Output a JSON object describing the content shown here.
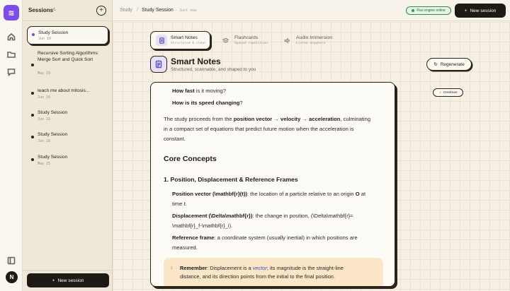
{
  "rail": {
    "logo_glyph": "≋",
    "avatar_initial": "N",
    "icons": [
      "home-icon",
      "folder-icon",
      "chat-icon",
      "panel-icon"
    ]
  },
  "sidebar": {
    "title": "Sessions",
    "count": "6",
    "add_glyph": "+",
    "sessions": [
      {
        "name": "Study Session",
        "date": "Jun 19",
        "active": true
      },
      {
        "name": "Recursive Sorting Algorithms: Merge Sort and Quick Sort",
        "date": "May 29",
        "active": false
      },
      {
        "name": "teach me about mitosis...",
        "date": "Jun 18",
        "active": false
      },
      {
        "name": "Study Session",
        "date": "Jun 18",
        "active": false
      },
      {
        "name": "Study Session",
        "date": "Jun 18",
        "active": false
      },
      {
        "name": "Study Session",
        "date": "May 25",
        "active": false
      }
    ],
    "new_session_label": "New session"
  },
  "topbar": {
    "crumb_root": "Study",
    "crumb_sep": "/",
    "crumb_current": "Study Session",
    "time": "· Just now",
    "engine_label": "Flux engine online",
    "new_session_label": "New session"
  },
  "modes": [
    {
      "label": "Smart Notes",
      "sub": "Structured & clear",
      "active": true
    },
    {
      "label": "Flashcards",
      "sub": "Spaced repetition",
      "active": false
    },
    {
      "label": "Audio Immersion",
      "sub": "Listen anywhere",
      "active": false
    }
  ],
  "header": {
    "title": "Smart Notes",
    "subtitle": "Structured, scannable, and shaped to you",
    "regenerate_label": "Regenerate",
    "model_badge": "Cerebras"
  },
  "doc": {
    "q1_bold": "How fast",
    "q1_rest": " is it moving?",
    "q2_bold": "How is its speed changing",
    "q2_rest": "?",
    "p1_a": "The study proceeds from the ",
    "p1_b": "position vector → velocity → acceleration",
    "p1_c": ", culminating",
    "p1_line2": "in a compact set of equations that predict future motion when the acceleration is",
    "p1_line3": "constant.",
    "h_core": "Core Concepts",
    "h_sub1": "1. Position, Displacement & Reference Frames",
    "pos_bold": "Position vector (\\mathbf{r}(t))",
    "pos_rest": ": the location of a particle relative to an origin ",
    "pos_o": "O",
    "pos_at": " at",
    "pos_line2_a": "time ",
    "pos_line2_t": "t",
    "pos_line2_b": ".",
    "disp_bold": "Displacement (\\Delta\\mathbf{r})",
    "disp_rest": ": the change in position, (\\Delta\\mathbf{r}=",
    "disp_line2": "\\mathbf{r}_f-\\mathbf{r}_i).",
    "ref_bold": "Reference frame",
    "ref_rest": ": a coordinate system (usually inertial) in which positions are",
    "ref_line2": "measured.",
    "callout_bold": "Remember",
    "callout_a": ": Displacement is a ",
    "callout_vec": "vector",
    "callout_b": "; its magnitude is the straight-line",
    "callout_line2": "distance, and its direction points from the initial to the final position."
  }
}
